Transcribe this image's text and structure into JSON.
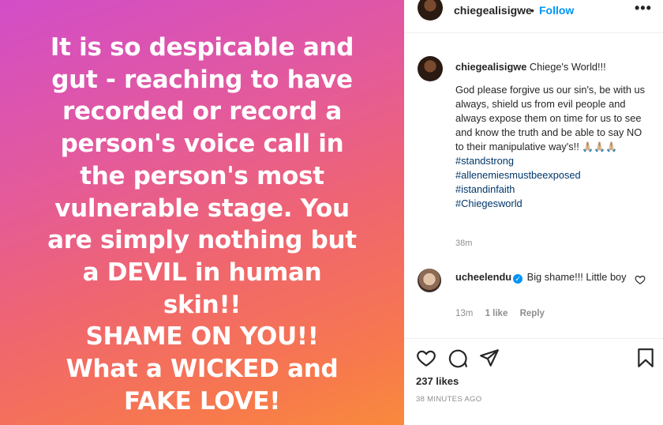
{
  "post_image": {
    "lines": [
      "It is so despicable and",
      "gut - reaching to have",
      "recorded or record a",
      "person's voice call in",
      "the person's most",
      "vulnerable stage. You",
      "are simply nothing but",
      "a DEVIL in human",
      "skin!!",
      "SHAME ON YOU!!",
      "What a WICKED and",
      "FAKE LOVE!"
    ]
  },
  "header": {
    "username": "chiegealisigwe",
    "separator": "•",
    "follow_label": "Follow",
    "more_icon": "more-horizontal-icon"
  },
  "caption": {
    "username": "chiegealisigwe",
    "intro": "Chiege's World!!!",
    "body": "God please forgive us our sin's, be with us always, shield us from evil people and always expose them on time for us to see and know the truth and be able to say NO to their manipulative way's!!",
    "emojis": "🙏🏼🙏🏼🙏🏼",
    "hashtags": [
      "#standstrong",
      "#allenemiesmustbeexposed",
      "#istandinfaith",
      "#Chiegesworld"
    ],
    "time": "38m"
  },
  "comment": {
    "username": "ucheelendu",
    "verified_icon": "verified-badge-icon",
    "text": "Big shame!!! Little boy",
    "time": "13m",
    "likes": "1 like",
    "reply_label": "Reply"
  },
  "actions": {
    "icons": [
      "heart-icon",
      "comment-icon",
      "share-icon",
      "bookmark-icon"
    ]
  },
  "likes_count": "237 likes",
  "posted_ago": "38 MINUTES AGO",
  "colors": {
    "follow": "#0095f6",
    "hashtag": "#00376b",
    "muted": "#8e8e8e",
    "gradient_start": "#d24dc8",
    "gradient_end": "#f98a3c"
  }
}
